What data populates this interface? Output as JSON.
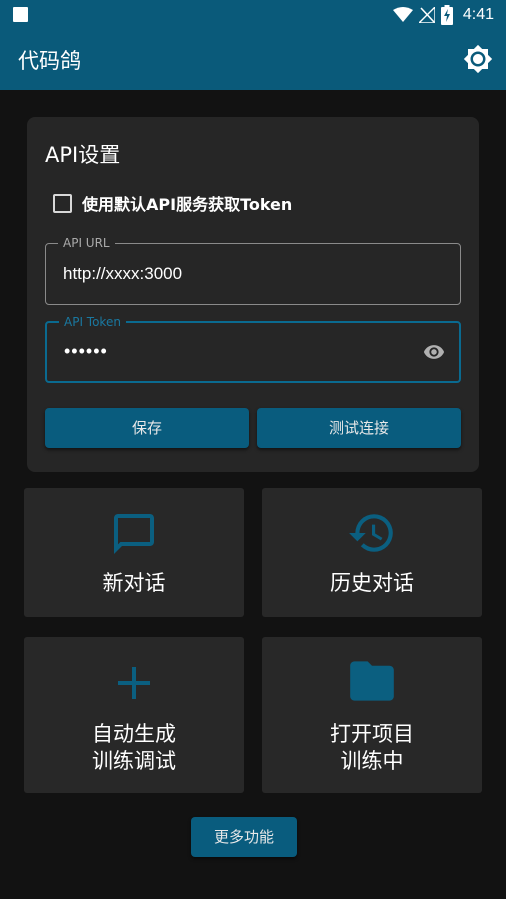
{
  "status_bar": {
    "time": "4:41",
    "icons": [
      "notification-square-icon",
      "wifi-icon",
      "signal-off-icon",
      "battery-charging-icon"
    ]
  },
  "app_bar": {
    "title": "代码鸽",
    "settings_icon": "brightness-settings-icon"
  },
  "api_settings": {
    "title": "API设置",
    "use_default_label": "使用默认API服务获取Token",
    "use_default_checked": false,
    "api_url": {
      "label": "API URL",
      "value": "http://xxxx:3000"
    },
    "api_token": {
      "label": "API Token",
      "value": "••••••"
    },
    "save_label": "保存",
    "test_label": "测试连接"
  },
  "tiles": [
    {
      "label": "新对话",
      "icon": "chat-bubble-icon"
    },
    {
      "label": "历史对话",
      "icon": "history-icon"
    },
    {
      "label": "自动生成\n训练调试",
      "icon": "plus-icon"
    },
    {
      "label": "打开项目\n训练中",
      "icon": "folder-icon"
    }
  ],
  "more_label": "更多功能",
  "colors": {
    "primary": "#0a5a7a",
    "button": "#095c7e",
    "background": "#121212",
    "card": "#262626",
    "icon_accent": "#0b5f80"
  }
}
